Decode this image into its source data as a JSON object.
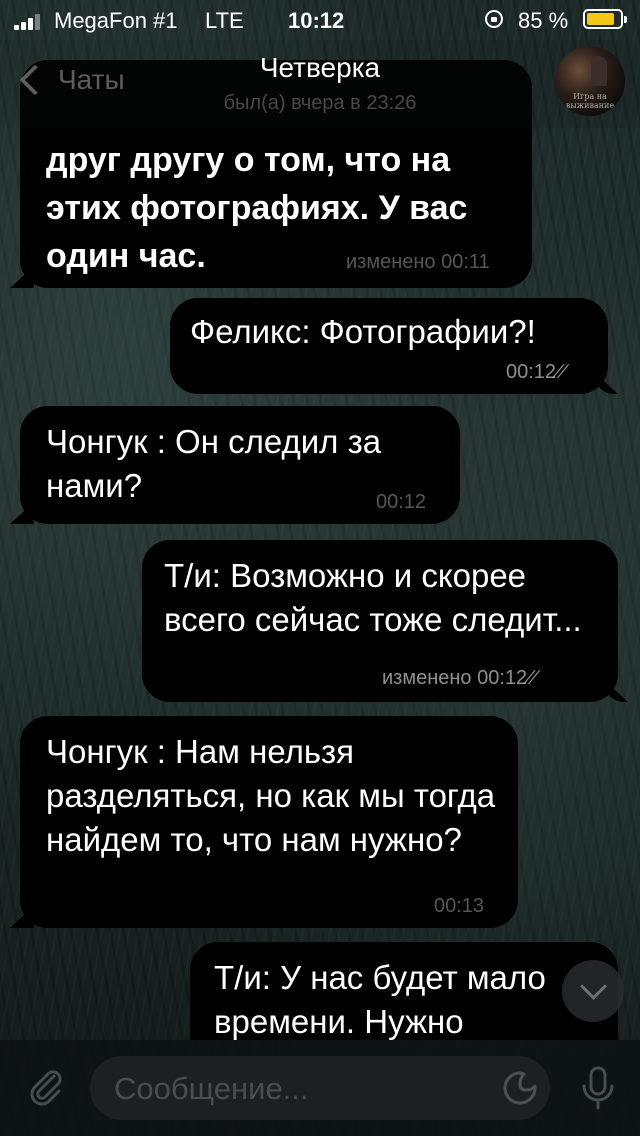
{
  "status_bar": {
    "carrier": "MegaFon #1",
    "network": "LTE",
    "time": "10:12",
    "battery_percent": "85 %",
    "battery_level": 0.85,
    "battery_color": "#f4c617"
  },
  "header": {
    "back_label": "Чаты",
    "title": "Четверка",
    "status": "был(а) вчера в 23:26",
    "avatar_caption": "Игра на выживание"
  },
  "messages": [
    {
      "direction": "in",
      "text": "друг другу о том, что на этих фотографиях. У вас один час.",
      "meta": "изменено 00:11",
      "bold": true
    },
    {
      "direction": "out",
      "text": "Феликс: Фотографии?!",
      "meta": "00:12",
      "read": true
    },
    {
      "direction": "in",
      "text": "Чонгук : Он следил за нами?",
      "meta": "00:12"
    },
    {
      "direction": "out",
      "text": "Т/и: Возможно и скорее всего сейчас тоже следит...",
      "meta": "изменено 00:12",
      "read": true
    },
    {
      "direction": "in",
      "text": "Чонгук : Нам нельзя разделяться, но как мы тогда найдем то, что нам нужно?",
      "meta": "00:13"
    },
    {
      "direction": "out",
      "text": "Т/и: У нас будет мало времени. Нужно",
      "meta": ""
    }
  ],
  "input": {
    "placeholder": "Сообщение..."
  },
  "icons": {
    "attach": "paperclip-icon",
    "sticker": "sticker-icon",
    "mic": "microphone-icon",
    "scroll": "chevron-down-icon",
    "back": "chevron-left-icon",
    "lock": "rotation-lock-icon"
  }
}
